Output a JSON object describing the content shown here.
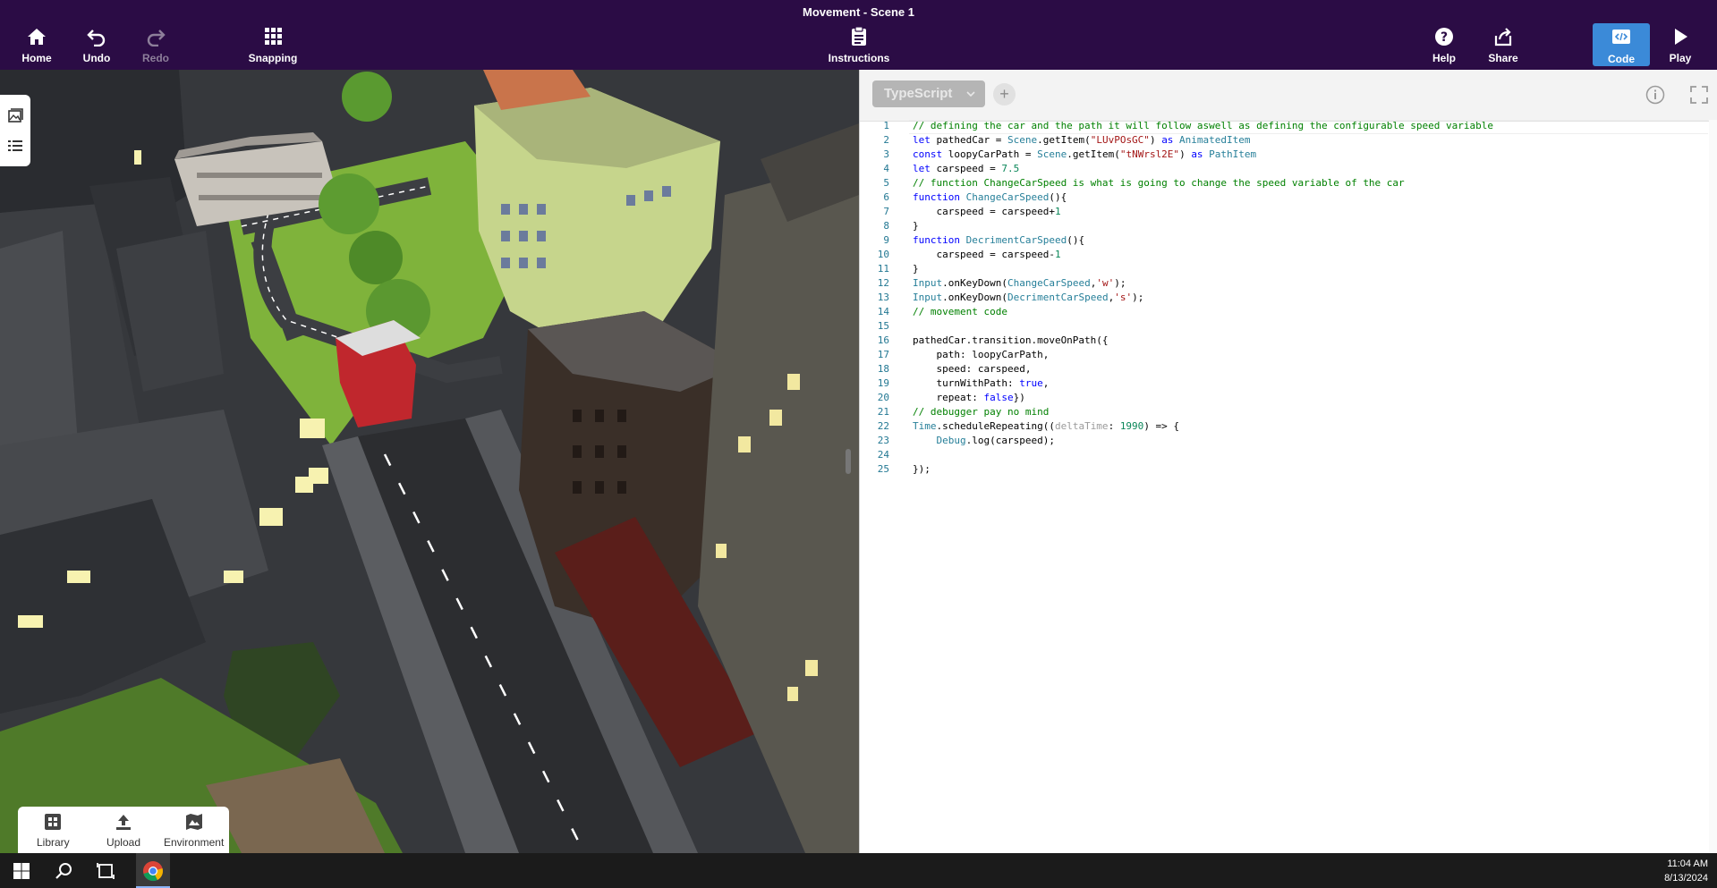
{
  "window": {
    "title": "Movement - Scene 1"
  },
  "toolbar": {
    "home": "Home",
    "undo": "Undo",
    "redo": "Redo",
    "snapping": "Snapping",
    "instructions": "Instructions",
    "help": "Help",
    "share": "Share",
    "code": "Code",
    "play": "Play"
  },
  "dock": {
    "library": "Library",
    "upload": "Upload",
    "environment": "Environment"
  },
  "code_panel": {
    "language": "TypeScript",
    "add_tab": "+",
    "lines": [
      {
        "n": "1"
      },
      {
        "n": "2"
      },
      {
        "n": "3"
      },
      {
        "n": "4"
      },
      {
        "n": "5"
      },
      {
        "n": "6"
      },
      {
        "n": "7"
      },
      {
        "n": "8"
      },
      {
        "n": "9"
      },
      {
        "n": "10"
      },
      {
        "n": "11"
      },
      {
        "n": "12"
      },
      {
        "n": "13"
      },
      {
        "n": "14"
      },
      {
        "n": "15"
      },
      {
        "n": "16"
      },
      {
        "n": "17"
      },
      {
        "n": "18"
      },
      {
        "n": "19"
      },
      {
        "n": "20"
      },
      {
        "n": "21"
      },
      {
        "n": "22"
      },
      {
        "n": "23"
      },
      {
        "n": "24"
      },
      {
        "n": "25"
      }
    ],
    "code": {
      "l1_comment": "// defining the car and the path it will follow aswell as defining the configurable speed variable",
      "l2_kw": "let",
      "l2_var": " pathedCar = ",
      "l2_obj": "Scene",
      "l2_call": ".getItem(",
      "l2_str": "\"LUvPOsGC\"",
      "l2_close": ") ",
      "l2_as": "as",
      "l2_type": " AnimatedItem",
      "l3_kw": "const",
      "l3_var": " loopyCarPath = ",
      "l3_obj": "Scene",
      "l3_call": ".getItem(",
      "l3_str": "\"tNWrsl2E\"",
      "l3_close": ") ",
      "l3_as": "as",
      "l3_type": " PathItem",
      "l4_kw": "let",
      "l4_var": " carspeed = ",
      "l4_num": "7.5",
      "l5_comment": "// function ChangeCarSpeed is what is going to change the speed variable of the car",
      "l6_kw": "function",
      "l6_fn": " ChangeCarSpeed",
      "l6_rest": "(){",
      "l7_text": "    carspeed = carspeed+",
      "l7_num": "1",
      "l8_text": "}",
      "l9_kw": "function",
      "l9_fn": " DecrimentCarSpeed",
      "l9_rest": "(){",
      "l10_text": "    carspeed = carspeed-",
      "l10_num": "1",
      "l11_text": "}",
      "l12_obj": "Input",
      "l12_call": ".onKeyDown(",
      "l12_fn": "ChangeCarSpeed",
      "l12_comma": ",",
      "l12_str": "'w'",
      "l12_end": ");",
      "l13_obj": "Input",
      "l13_call": ".onKeyDown(",
      "l13_fn": "DecrimentCarSpeed",
      "l13_comma": ",",
      "l13_str": "'s'",
      "l13_end": ");",
      "l14_comment": "// movement code",
      "l16_text": "pathedCar.transition.moveOnPath({",
      "l17_text": "    path: loopyCarPath,",
      "l18_text": "    speed: carspeed,",
      "l19_text": "    turnWithPath: ",
      "l19_kw": "true",
      "l19_end": ",",
      "l20_text": "    repeat: ",
      "l20_kw": "false",
      "l20_end": "})",
      "l21_comment": "// debugger pay no mind",
      "l22_obj": "Time",
      "l22_call": ".scheduleRepeating((",
      "l22_hint": "deltaTime",
      "l22_colon": ": ",
      "l22_num": "1990",
      "l22_end": ") => {",
      "l23_indent": "    ",
      "l23_obj": "Debug",
      "l23_call": ".log(carspeed);",
      "l25_text": "});"
    }
  },
  "taskbar": {
    "time": "11:04 AM",
    "date": "8/13/2024"
  },
  "colors": {
    "toolbar_bg": "#2b0c45",
    "accent": "#3b8ad8"
  },
  "icons": [
    "home-icon",
    "undo-icon",
    "redo-icon",
    "grid-icon",
    "clipboard-icon",
    "help-icon",
    "share-icon",
    "code-icon",
    "play-icon",
    "info-icon",
    "expand-icon",
    "close-icon",
    "library-icon",
    "upload-icon",
    "environment-icon",
    "windows-start-icon",
    "search-icon",
    "task-view-icon",
    "chrome-icon"
  ]
}
